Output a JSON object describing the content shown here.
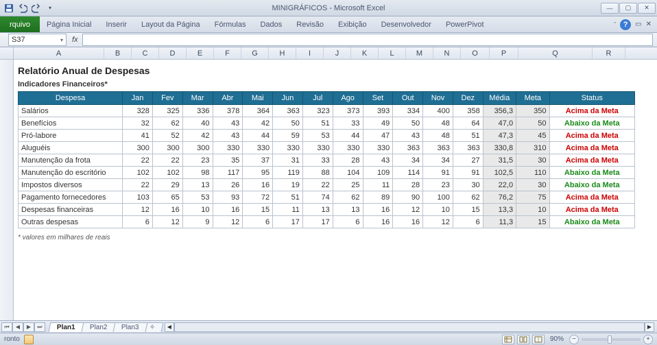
{
  "window": {
    "title": "MINIGRÁFICOS  -  Microsoft Excel"
  },
  "ribbon": {
    "file": "rquivo",
    "tabs": [
      "Página Inicial",
      "Inserir",
      "Layout da Página",
      "Fórmulas",
      "Dados",
      "Revisão",
      "Exibição",
      "Desenvolvedor",
      "PowerPivot"
    ]
  },
  "formula": {
    "name_box": "S37",
    "fx_label": "fx",
    "value": ""
  },
  "columns": [
    "A",
    "B",
    "C",
    "D",
    "E",
    "F",
    "G",
    "H",
    "I",
    "J",
    "K",
    "L",
    "M",
    "N",
    "O",
    "P",
    "Q",
    "R"
  ],
  "report": {
    "title": "Relatório Anual de Despesas",
    "subtitle": "Indicadores Financeiros*",
    "footnote": "* valores em milhares de reais",
    "headers": {
      "despesa": "Despesa",
      "months": [
        "Jan",
        "Fev",
        "Mar",
        "Abr",
        "Mai",
        "Jun",
        "Jul",
        "Ago",
        "Set",
        "Out",
        "Nov",
        "Dez"
      ],
      "media": "Média",
      "meta": "Meta",
      "status": "Status"
    },
    "status_labels": {
      "acima": "Acima da Meta",
      "abaixo": "Abaixo da Meta"
    },
    "rows": [
      {
        "name": "Salários",
        "v": [
          328,
          325,
          336,
          378,
          364,
          363,
          323,
          373,
          393,
          334,
          400,
          358
        ],
        "media": "356,3",
        "meta": 350,
        "status": "acima"
      },
      {
        "name": "Benefícios",
        "v": [
          32,
          62,
          40,
          43,
          42,
          50,
          51,
          33,
          49,
          50,
          48,
          64
        ],
        "media": "47,0",
        "meta": 50,
        "status": "abaixo"
      },
      {
        "name": "Pró-labore",
        "v": [
          41,
          52,
          42,
          43,
          44,
          59,
          53,
          44,
          47,
          43,
          48,
          51
        ],
        "media": "47,3",
        "meta": 45,
        "status": "acima"
      },
      {
        "name": "Aluguéis",
        "v": [
          300,
          300,
          300,
          330,
          330,
          330,
          330,
          330,
          330,
          363,
          363,
          363
        ],
        "media": "330,8",
        "meta": 310,
        "status": "acima"
      },
      {
        "name": "Manutenção da frota",
        "v": [
          22,
          22,
          23,
          35,
          37,
          31,
          33,
          28,
          43,
          34,
          34,
          27
        ],
        "media": "31,5",
        "meta": 30,
        "status": "acima"
      },
      {
        "name": "Manutenção do escritório",
        "v": [
          102,
          102,
          98,
          117,
          95,
          119,
          88,
          104,
          109,
          114,
          91,
          91
        ],
        "media": "102,5",
        "meta": 110,
        "status": "abaixo"
      },
      {
        "name": "Impostos diversos",
        "v": [
          22,
          29,
          13,
          26,
          16,
          19,
          22,
          25,
          11,
          28,
          23,
          30
        ],
        "media": "22,0",
        "meta": 30,
        "status": "abaixo"
      },
      {
        "name": "Pagamento fornecedores",
        "v": [
          103,
          65,
          53,
          93,
          72,
          51,
          74,
          62,
          89,
          90,
          100,
          62
        ],
        "media": "76,2",
        "meta": 75,
        "status": "acima"
      },
      {
        "name": "Despesas financeiras",
        "v": [
          12,
          16,
          10,
          16,
          15,
          11,
          13,
          13,
          16,
          12,
          10,
          15
        ],
        "media": "13,3",
        "meta": 10,
        "status": "acima"
      },
      {
        "name": "Outras despesas",
        "v": [
          6,
          12,
          9,
          12,
          6,
          17,
          17,
          6,
          16,
          16,
          12,
          6
        ],
        "media": "11,3",
        "meta": 15,
        "status": "abaixo"
      }
    ]
  },
  "sheets": {
    "tabs": [
      "Plan1",
      "Plan2",
      "Plan3"
    ],
    "active": 0
  },
  "status": {
    "mode": "ronto",
    "zoom": "90%"
  }
}
